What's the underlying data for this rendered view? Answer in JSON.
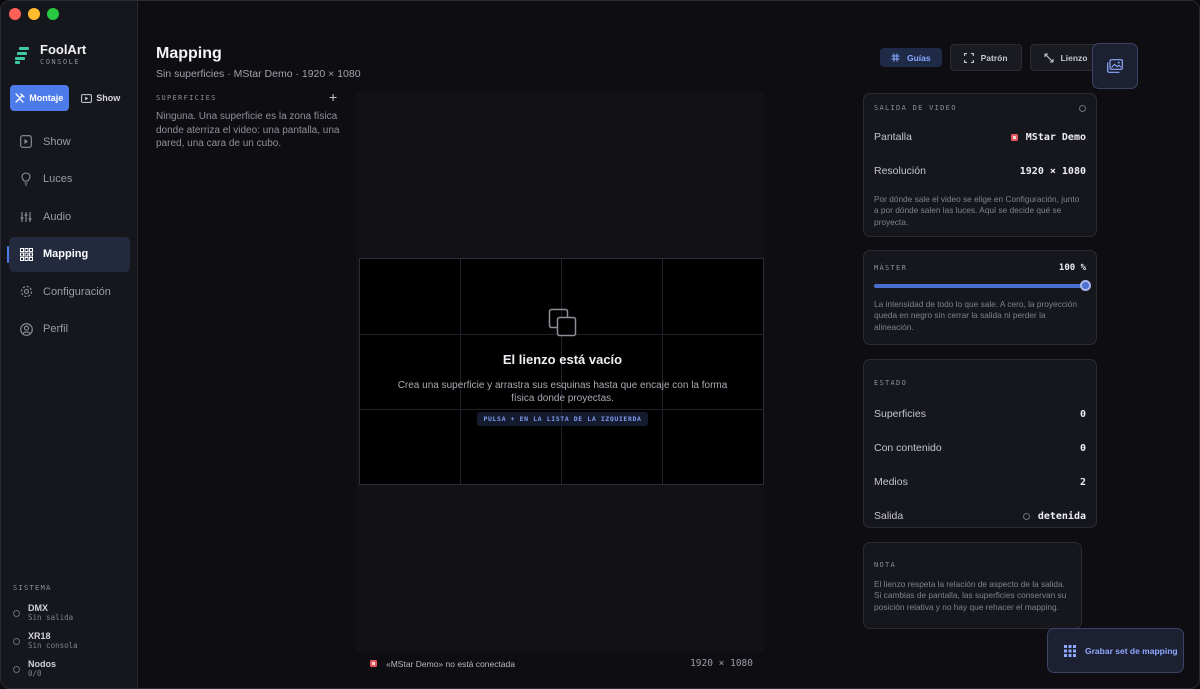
{
  "window": {
    "traffic": [
      "close",
      "minimize",
      "zoom"
    ]
  },
  "brand": {
    "name": "FoolArt",
    "sub": "CONSOLE"
  },
  "modes": [
    {
      "label": "Montaje",
      "icon": "tools-icon",
      "active": true
    },
    {
      "label": "Show",
      "icon": "play-icon",
      "active": false
    }
  ],
  "nav": [
    {
      "label": "Show",
      "icon": "show-icon",
      "active": false
    },
    {
      "label": "Luces",
      "icon": "bulb-icon",
      "active": false
    },
    {
      "label": "Audio",
      "icon": "sliders-icon",
      "active": false
    },
    {
      "label": "Mapping",
      "icon": "grid-icon",
      "active": true
    },
    {
      "label": "Configuración",
      "icon": "gear-icon",
      "active": false
    },
    {
      "label": "Perfil",
      "icon": "user-icon",
      "active": false
    }
  ],
  "system": {
    "title": "SISTEMA",
    "items": [
      {
        "name": "DMX",
        "status": "Sin salida"
      },
      {
        "name": "XR18",
        "status": "Sin consola"
      },
      {
        "name": "Nodos",
        "status": "0/0"
      }
    ]
  },
  "header": {
    "title": "Mapping",
    "subtitle": "Sin superficies · MStar Demo · 1920 × 1080"
  },
  "toolbar": {
    "guides": "Guías",
    "pattern": "Patrón",
    "canvas": "Lienzo"
  },
  "surfaces": {
    "title": "SUPERFICIES",
    "add": "+",
    "empty": "Ninguna. Una superficie es la zona física donde aterriza el video: una pantalla, una pared, una cara de un cubo."
  },
  "canvas": {
    "empty_title": "El lienzo está vacío",
    "empty_desc": "Crea una superficie y arrastra sus esquinas hasta que encaje con la forma física donde proyectas.",
    "hint": "PULSA + EN LA LISTA DE LA IZQUIERDA",
    "footer_msg": "«MStar Demo» no está conectada",
    "footer_res": "1920 × 1080"
  },
  "video_out": {
    "title": "SALIDA DE VIDEO",
    "screen_label": "Pantalla",
    "screen_value": "MStar Demo",
    "res_label": "Resolución",
    "res_value": "1920 × 1080",
    "note": "Por dónde sale el video se elige en Configuración, junto a por dónde salen las luces. Aquí se decide qué se proyecta."
  },
  "master": {
    "title": "MÁSTER",
    "value": "100 %",
    "level": 1.0,
    "note": "La intensidad de todo lo que sale. A cero, la proyección queda en negro sin cerrar la salida ni perder la alineación."
  },
  "status": {
    "title": "ESTADO",
    "rows": [
      {
        "label": "Superficies",
        "value": "0"
      },
      {
        "label": "Con contenido",
        "value": "0"
      },
      {
        "label": "Medios",
        "value": "2"
      },
      {
        "label": "Salida",
        "value": "detenida"
      }
    ]
  },
  "note_panel": {
    "title": "NOTA",
    "text": "El lienzo respeta la relación de aspecto de la salida. Si cambias de pantalla, las superficies conservan su posición relativa y no hay que rehacer el mapping."
  },
  "record": {
    "label": "Grabar set de mapping"
  },
  "colors": {
    "accent": "#4d7bea",
    "brand": "#3ec9a7",
    "alert": "#e05861"
  }
}
